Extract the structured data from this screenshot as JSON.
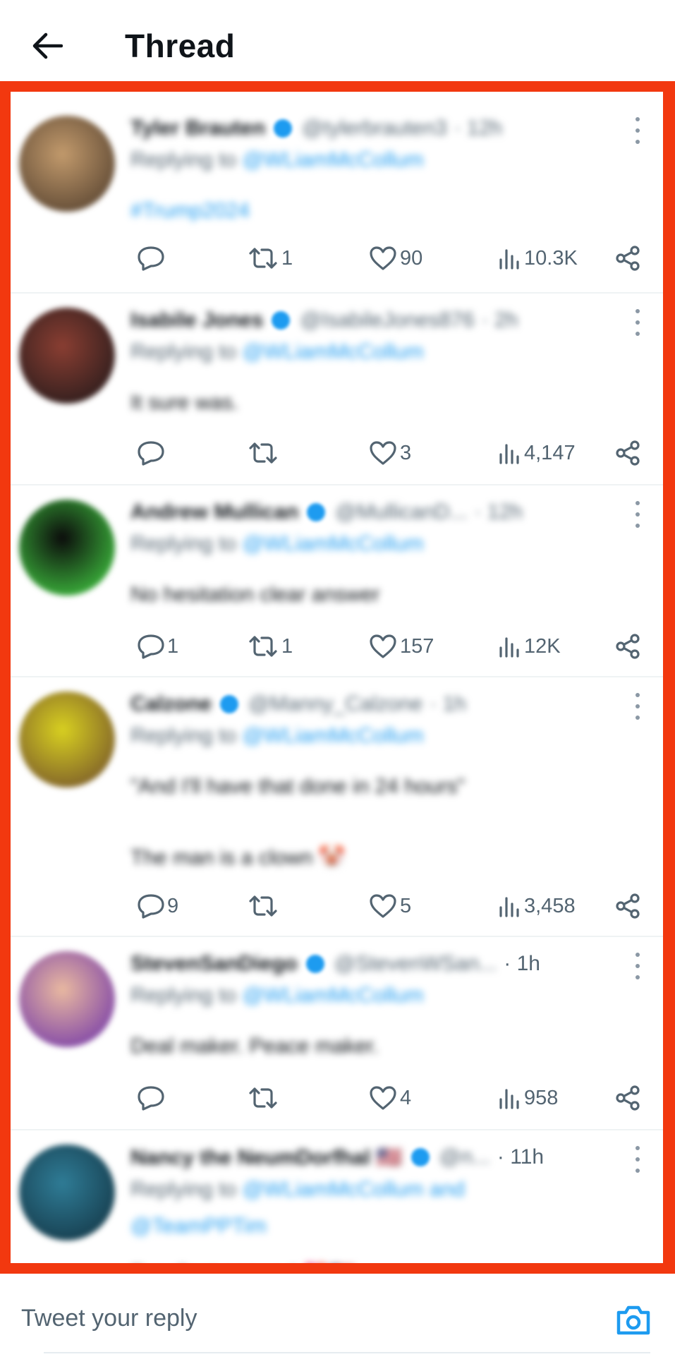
{
  "header": {
    "title": "Thread"
  },
  "colors": {
    "highlight": "#f2380f",
    "accent": "#1d9bf0",
    "secondary_text": "#536471"
  },
  "replies": [
    {
      "author": "Tyler Brauten",
      "handle": "@tylerbrauten3",
      "time": "· 12h",
      "time_blurred": true,
      "replying_prefix": "Replying to",
      "replying_to": "@WLiamMcCollum",
      "body": [
        "#Trump2024"
      ],
      "body_is_link": true,
      "avatar_colors": [
        "#c29a6c",
        "#5b4632"
      ],
      "stats": {
        "replies": "",
        "retweets": "1",
        "likes": "90",
        "views": "10.3K"
      }
    },
    {
      "author": "Isabile Jones",
      "handle": "@IsabileJones876",
      "time": "· 2h",
      "time_blurred": true,
      "replying_prefix": "Replying to",
      "replying_to": "@WLiamMcCollum",
      "body": [
        "It sure was."
      ],
      "body_is_link": false,
      "avatar_colors": [
        "#8a3e32",
        "#2a1c1c"
      ],
      "stats": {
        "replies": "",
        "retweets": "",
        "likes": "3",
        "views": "4,147"
      }
    },
    {
      "author": "Andrew Mullican",
      "handle": "@MullicanD...",
      "time": "· 12h",
      "time_blurred": true,
      "replying_prefix": "Replying to",
      "replying_to": "@WLiamMcCollum",
      "body": [
        "No hesitation clear answer"
      ],
      "body_is_link": false,
      "avatar_colors": [
        "#0b0b0b",
        "#3fbf3f"
      ],
      "stats": {
        "replies": "1",
        "retweets": "1",
        "likes": "157",
        "views": "12K"
      }
    },
    {
      "author": "Calzone",
      "handle": "@Manny_Calzone",
      "time": "· 1h",
      "time_blurred": true,
      "replying_prefix": "Replying to",
      "replying_to": "@WLiamMcCollum",
      "body": [
        "\"And I'll have that done in 24 hours\"",
        "",
        "The man is a clown 🤡"
      ],
      "body_is_link": false,
      "avatar_colors": [
        "#d8d020",
        "#7a5a2a"
      ],
      "stats": {
        "replies": "9",
        "retweets": "",
        "likes": "5",
        "views": "3,458"
      }
    },
    {
      "author": "StevenSanDiego",
      "handle": "@StevenWSan...",
      "time": "· 1h",
      "time_blurred": false,
      "replying_prefix": "Replying to",
      "replying_to": "@WLiamMcCollum",
      "body": [
        "Deal maker. Peace maker."
      ],
      "body_is_link": false,
      "avatar_colors": [
        "#e9b9a0",
        "#7a3fa8"
      ],
      "stats": {
        "replies": "",
        "retweets": "",
        "likes": "4",
        "views": "958"
      }
    },
    {
      "author": "Nancy the NeumDorfhal 🇺🇸",
      "handle": "@n...",
      "time": "· 11h",
      "time_blurred": false,
      "replying_prefix": "Replying to",
      "replying_to": "@WLiamMcCollum and @TeamPPTim",
      "body": [
        "Excellent answer! 💖🇺🇸"
      ],
      "body_is_link": false,
      "avatar_colors": [
        "#2f7c96",
        "#153a4a"
      ],
      "stats": {
        "replies": "",
        "retweets": "",
        "likes": "",
        "views": ""
      }
    }
  ],
  "reply_bar": {
    "placeholder": "Tweet your reply"
  },
  "icons": {
    "back": "arrow-left-icon",
    "more": "more-vertical-icon",
    "reply": "reply-bubble-icon",
    "retweet": "retweet-icon",
    "like": "heart-icon",
    "views": "views-bars-icon",
    "share": "share-icon",
    "camera": "camera-icon"
  }
}
